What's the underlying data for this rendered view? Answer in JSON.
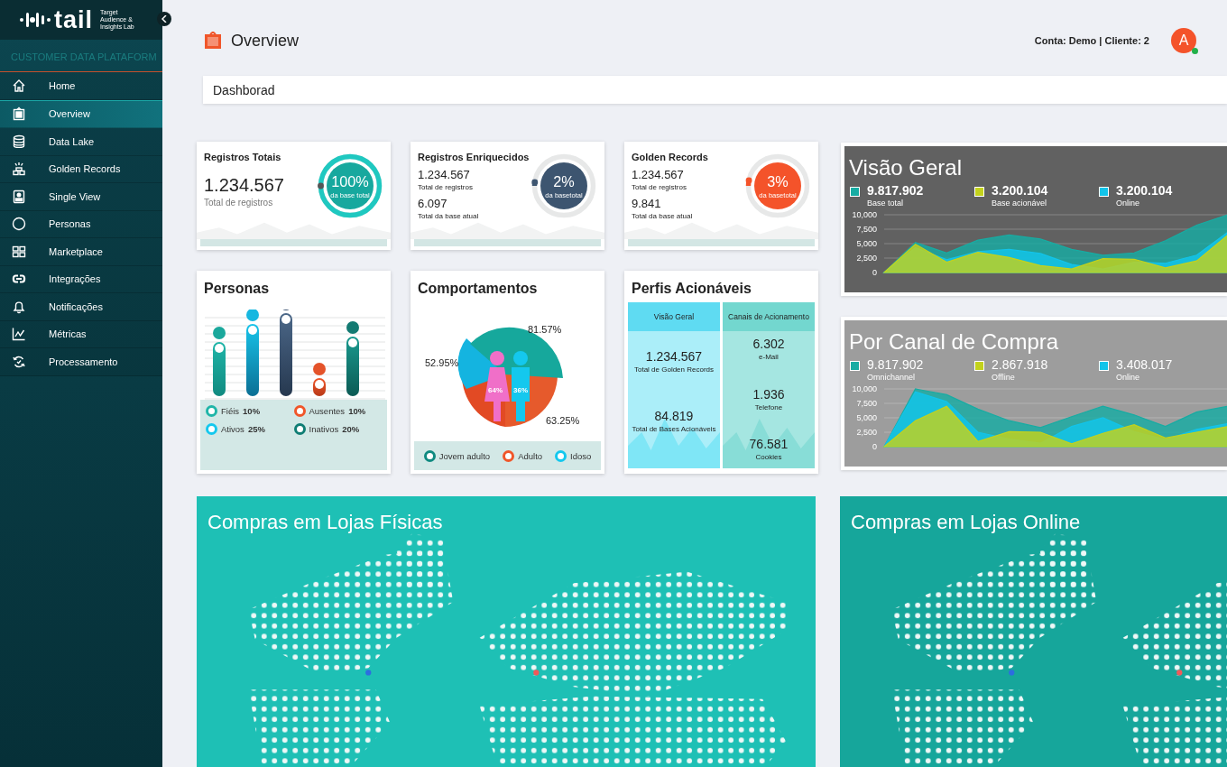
{
  "sidebar": {
    "logo": {
      "wordmark": "tail",
      "tagline": [
        "Target",
        "Audience &",
        "Insights Lab"
      ]
    },
    "section_title": "CUSTOMER DATA PLATAFORM",
    "items": [
      {
        "label": "Home",
        "kind": "home",
        "selected": false
      },
      {
        "label": "Overview",
        "kind": "clipboard",
        "selected": true
      },
      {
        "label": "Data Lake",
        "kind": "database",
        "selected": false
      },
      {
        "label": "Golden Records",
        "kind": "podium",
        "selected": false
      },
      {
        "label": "Single View",
        "kind": "card",
        "selected": false
      },
      {
        "label": "Personas",
        "kind": "circle",
        "selected": false
      },
      {
        "label": "Marketplace",
        "kind": "grid",
        "selected": false
      },
      {
        "label": "Integrações",
        "kind": "link",
        "selected": false
      },
      {
        "label": "Notificações",
        "kind": "bell",
        "selected": false
      },
      {
        "label": "Métricas",
        "kind": "chart",
        "selected": false
      },
      {
        "label": "Processamento",
        "kind": "refresh",
        "selected": false
      }
    ]
  },
  "header": {
    "title": "Overview",
    "account": "Conta: Demo | Cliente: 2",
    "avatar": {
      "initial": "A",
      "online": true
    }
  },
  "dashboard": {
    "title": "Dashborad"
  },
  "stat_cards": [
    {
      "title": "Registros Totais",
      "color": "#17a89e",
      "gauge": {
        "percent": "100%",
        "caption": "da base total",
        "level": 1
      },
      "metrics": [
        {
          "value": "1.234.567",
          "label": "Total de registros"
        }
      ]
    },
    {
      "title": "Registros Enriquecidos",
      "color": "#3d5570",
      "gauge": {
        "percent": "2%",
        "caption": "da basetotal",
        "level": 0.02
      },
      "metrics": [
        {
          "value": "1.234.567",
          "label": "Total de registros"
        },
        {
          "value": "6.097",
          "label": "Total da base atual"
        }
      ]
    },
    {
      "title": "Golden Records",
      "color": "#f4532a",
      "gauge": {
        "percent": "3%",
        "caption": "da basetotal",
        "level": 0.03
      },
      "metrics": [
        {
          "value": "1.234.567",
          "label": "Total de registros"
        },
        {
          "value": "9.841",
          "label": "Total da base atual"
        }
      ]
    }
  ],
  "personas": {
    "title": "Personas",
    "legend": [
      {
        "label": "Fiéis",
        "value": "10%",
        "color": "#1fb5a8"
      },
      {
        "label": "Ausentes",
        "value": "10%",
        "color": "#f0562a"
      },
      {
        "label": "Ativos",
        "value": "25%",
        "color": "#14c8ee"
      },
      {
        "label": "Inativos",
        "value": "20%",
        "color": "#0f7d74"
      }
    ]
  },
  "comportamentos": {
    "title": "Comportamentos",
    "slice_labels": [
      "81.57%",
      "52.95%",
      "63.25%"
    ],
    "figure_labels": [
      "64%",
      "36%"
    ],
    "legend": [
      {
        "label": "Jovem adulto",
        "color": "#0f8a80"
      },
      {
        "label": "Adulto",
        "color": "#f0562a"
      },
      {
        "label": "Idoso",
        "color": "#14c8ee"
      }
    ]
  },
  "perfis": {
    "title": "Perfis Acionáveis",
    "columns": [
      {
        "title": "Visão Geral",
        "metrics": [
          {
            "value": "1.234.567",
            "label": "Total de Golden Records"
          },
          {
            "value": "84.819",
            "label": "Total de Bases Acionáveis"
          }
        ]
      },
      {
        "title": "Canais de Acionamento",
        "metrics": [
          {
            "value": "6.302",
            "label": "e-Mail"
          },
          {
            "value": "1.936",
            "label": "Telefone"
          },
          {
            "value": "76.581",
            "label": "Cookies"
          }
        ]
      }
    ]
  },
  "area_panels": [
    {
      "title": "Visão Geral",
      "bold": true,
      "legend": [
        {
          "value": "9.817.902"
        },
        {
          "value": "3.200.104"
        },
        {
          "value": "3.200.104"
        }
      ],
      "chart_data": {
        "type": "area",
        "categories": [
          null,
          null,
          null,
          null,
          null,
          null,
          null,
          null,
          null,
          null,
          null,
          null
        ],
        "ylim": [
          0,
          10000
        ],
        "grid": true,
        "yticks": [
          {
            "value": 0,
            "label": "0"
          },
          {
            "value": 2500,
            "label": "2,500"
          },
          {
            "value": 5000,
            "label": "5,000"
          },
          {
            "value": 7500,
            "label": "7,500"
          },
          {
            "value": 10000,
            "label": "10,000"
          }
        ],
        "series": [
          {
            "name": "Base total",
            "color": "#17aca3",
            "values": [
              0,
              5200,
              3400,
              5600,
              6500,
              5800,
              4000,
              3000,
              3400,
              5500,
              8200,
              10000
            ]
          },
          {
            "name": "Base acionável",
            "color": "#c3d21c",
            "values": [
              0,
              4900,
              1800,
              3500,
              2600,
              1200,
              600,
              2400,
              2300,
              800,
              2000,
              6500
            ]
          },
          {
            "name": "Online",
            "color": "#12c4ea",
            "values": [
              0,
              4300,
              2200,
              3600,
              4000,
              3300,
              1400,
              600,
              1800,
              1600,
              3000,
              7000
            ]
          }
        ]
      }
    },
    {
      "title": "Por Canal de Compra",
      "bold": false,
      "legend": [
        {
          "value": "9.817.902"
        },
        {
          "value": "2.867.918"
        },
        {
          "value": "3.408.017"
        }
      ],
      "chart_data": {
        "type": "area",
        "categories": [
          null,
          null,
          null,
          null,
          null,
          null,
          null,
          null,
          null,
          null,
          null,
          null
        ],
        "ylim": [
          0,
          10000
        ],
        "grid": true,
        "yticks": [
          {
            "value": 0,
            "label": "0"
          },
          {
            "value": 2500,
            "label": "2,500"
          },
          {
            "value": 5000,
            "label": "5,000"
          },
          {
            "value": 7500,
            "label": "7,500"
          },
          {
            "value": 10000,
            "label": "10,000"
          }
        ],
        "series": [
          {
            "name": "Omnichannel",
            "color": "#17aca3",
            "values": [
              0,
              10000,
              9000,
              6500,
              4500,
              3300,
              5200,
              7000,
              5500,
              3500,
              6000,
              7000
            ]
          },
          {
            "name": "Offline",
            "color": "#c3d21c",
            "values": [
              0,
              4500,
              7000,
              900,
              2600,
              2500,
              500,
              2300,
              3800,
              1500,
              2500,
              3500
            ]
          },
          {
            "name": "Online",
            "color": "#12c4ea",
            "values": [
              0,
              9500,
              7800,
              2500,
              1300,
              600,
              3500,
              5000,
              2600,
              1200,
              3000,
              4000
            ]
          }
        ]
      }
    }
  ],
  "maps": [
    {
      "title": "Compras em Lojas Físicas"
    },
    {
      "title": "Compras em Lojas Online"
    }
  ]
}
